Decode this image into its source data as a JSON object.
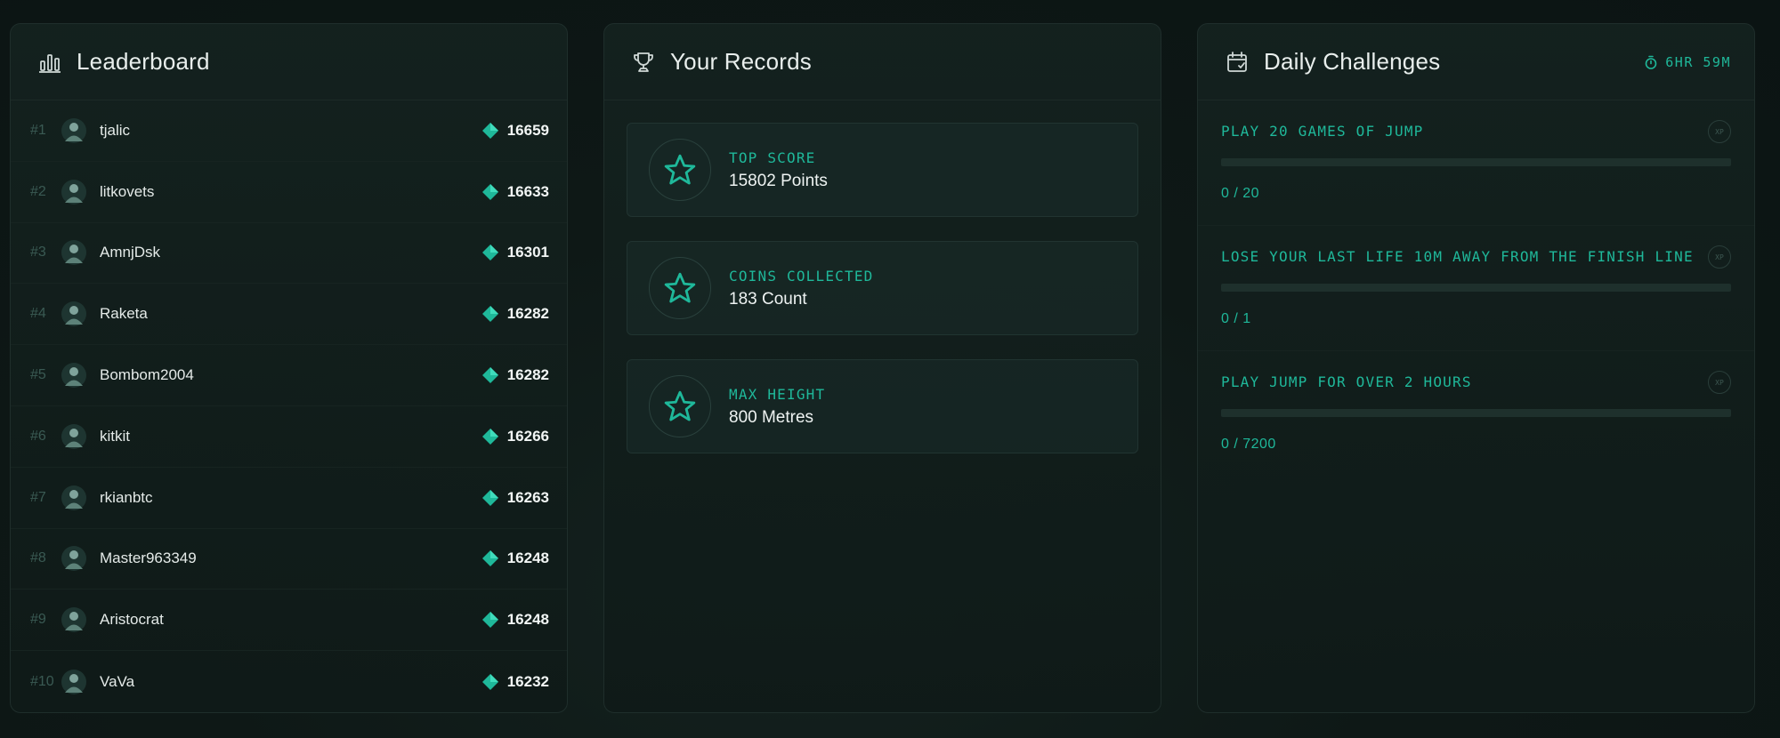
{
  "leaderboard": {
    "title": "Leaderboard",
    "icon": "bar-chart-icon",
    "rows": [
      {
        "rank": "#1",
        "name": "tjalic",
        "score": "16659"
      },
      {
        "rank": "#2",
        "name": "litkovets",
        "score": "16633"
      },
      {
        "rank": "#3",
        "name": "AmnjDsk",
        "score": "16301"
      },
      {
        "rank": "#4",
        "name": "Raketa",
        "score": "16282"
      },
      {
        "rank": "#5",
        "name": "Bombom2004",
        "score": "16282"
      },
      {
        "rank": "#6",
        "name": "kitkit",
        "score": "16266"
      },
      {
        "rank": "#7",
        "name": "rkianbtc",
        "score": "16263"
      },
      {
        "rank": "#8",
        "name": "Master963349",
        "score": "16248"
      },
      {
        "rank": "#9",
        "name": "Aristocrat",
        "score": "16248"
      },
      {
        "rank": "#10",
        "name": "VaVa",
        "score": "16232"
      }
    ]
  },
  "records": {
    "title": "Your Records",
    "icon": "trophy-icon",
    "items": [
      {
        "label": "TOP SCORE",
        "value": "15802 Points"
      },
      {
        "label": "COINS COLLECTED",
        "value": "183 Count"
      },
      {
        "label": "MAX HEIGHT",
        "value": "800 Metres"
      }
    ]
  },
  "daily": {
    "title": "Daily Challenges",
    "icon": "calendar-check-icon",
    "timer": "6HR 59M",
    "timer_icon": "stopwatch-icon",
    "challenges": [
      {
        "title": "PLAY 20 GAMES OF JUMP",
        "badge": "XP",
        "progress": "0 / 20",
        "fraction": 0
      },
      {
        "title": "LOSE YOUR LAST LIFE 10M AWAY FROM THE FINISH LINE",
        "badge": "XP",
        "progress": "0 / 1",
        "fraction": 0
      },
      {
        "title": "PLAY JUMP FOR OVER 2 HOURS",
        "badge": "XP",
        "progress": "0 / 7200",
        "fraction": 0
      }
    ]
  },
  "colors": {
    "accent": "#1fb89a",
    "background": "#0e1816",
    "panel": "#14221f"
  }
}
